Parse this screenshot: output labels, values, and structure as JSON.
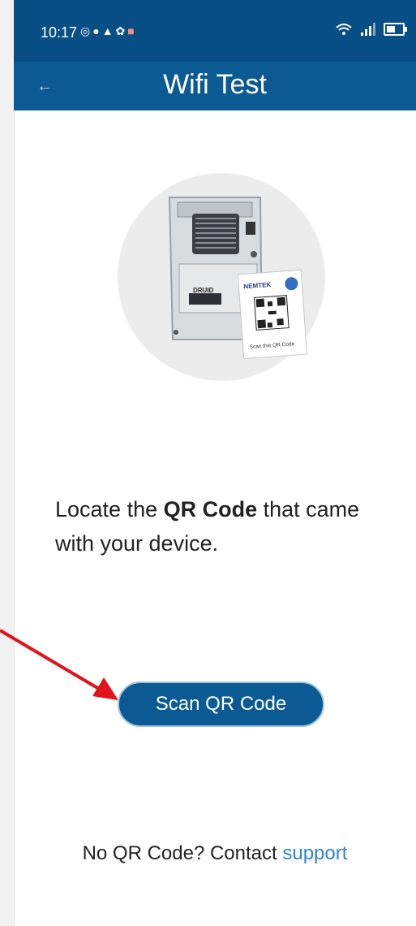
{
  "status_bar": {
    "time": "10:17",
    "left_icons": [
      "whatsapp-icon",
      "chat-icon",
      "notification-bell-icon",
      "app-icon",
      "shield-icon"
    ],
    "right_icons": [
      "wifi-6-icon",
      "signal-icon",
      "battery-icon"
    ]
  },
  "header": {
    "back_icon": "←",
    "title": "Wifi Test"
  },
  "illustration": {
    "brand_label": "NEMTEK",
    "device_label": "DRUID",
    "card_caption": "Scan this QR Code"
  },
  "instruction": {
    "prefix": "Locate the ",
    "emphasis": "QR Code",
    "suffix": " that came with your device."
  },
  "actions": {
    "scan_label": "Scan QR Code"
  },
  "footer": {
    "text": "No QR Code? Contact ",
    "link": "support"
  },
  "colors": {
    "primary": "#0b5a94",
    "status_bar": "#084f86",
    "link": "#2e86d4",
    "annotation": "#e0141a"
  }
}
